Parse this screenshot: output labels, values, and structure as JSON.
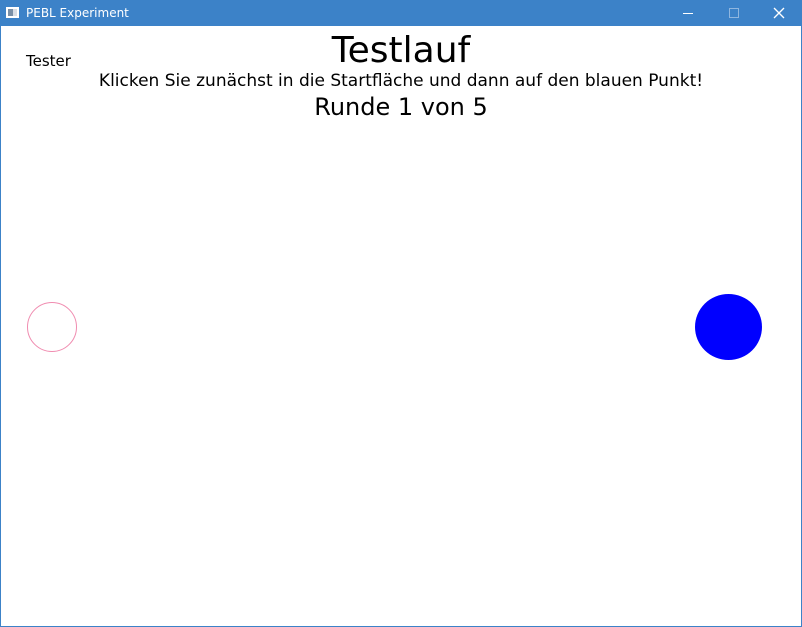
{
  "window": {
    "title": "PEBL Experiment",
    "controls": [
      "minimize",
      "maximize",
      "close"
    ]
  },
  "experiment": {
    "user_label": "Tester",
    "heading": "Testlauf",
    "instruction": "Klicken Sie zunächst in die Startfläche und dann auf den blauen Punkt!",
    "round_label": "Runde 1 von 5"
  },
  "colors": {
    "titlebar": "#3c82c8",
    "start_area_outline": "#f08cb0",
    "target_dot": "#0000ff",
    "background": "#ffffff"
  }
}
